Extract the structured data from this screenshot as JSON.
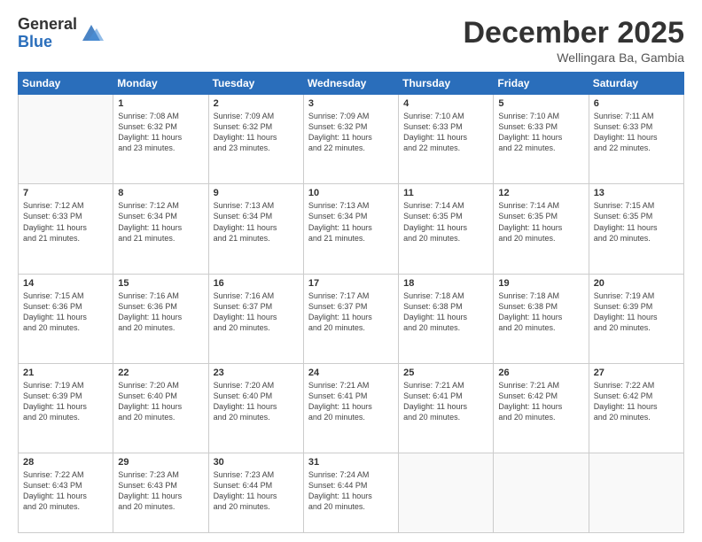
{
  "header": {
    "logo_general": "General",
    "logo_blue": "Blue",
    "month_title": "December 2025",
    "location": "Wellingara Ba, Gambia"
  },
  "days_of_week": [
    "Sunday",
    "Monday",
    "Tuesday",
    "Wednesday",
    "Thursday",
    "Friday",
    "Saturday"
  ],
  "weeks": [
    [
      {
        "num": "",
        "info": ""
      },
      {
        "num": "1",
        "info": "Sunrise: 7:08 AM\nSunset: 6:32 PM\nDaylight: 11 hours\nand 23 minutes."
      },
      {
        "num": "2",
        "info": "Sunrise: 7:09 AM\nSunset: 6:32 PM\nDaylight: 11 hours\nand 23 minutes."
      },
      {
        "num": "3",
        "info": "Sunrise: 7:09 AM\nSunset: 6:32 PM\nDaylight: 11 hours\nand 22 minutes."
      },
      {
        "num": "4",
        "info": "Sunrise: 7:10 AM\nSunset: 6:33 PM\nDaylight: 11 hours\nand 22 minutes."
      },
      {
        "num": "5",
        "info": "Sunrise: 7:10 AM\nSunset: 6:33 PM\nDaylight: 11 hours\nand 22 minutes."
      },
      {
        "num": "6",
        "info": "Sunrise: 7:11 AM\nSunset: 6:33 PM\nDaylight: 11 hours\nand 22 minutes."
      }
    ],
    [
      {
        "num": "7",
        "info": "Sunrise: 7:12 AM\nSunset: 6:33 PM\nDaylight: 11 hours\nand 21 minutes."
      },
      {
        "num": "8",
        "info": "Sunrise: 7:12 AM\nSunset: 6:34 PM\nDaylight: 11 hours\nand 21 minutes."
      },
      {
        "num": "9",
        "info": "Sunrise: 7:13 AM\nSunset: 6:34 PM\nDaylight: 11 hours\nand 21 minutes."
      },
      {
        "num": "10",
        "info": "Sunrise: 7:13 AM\nSunset: 6:34 PM\nDaylight: 11 hours\nand 21 minutes."
      },
      {
        "num": "11",
        "info": "Sunrise: 7:14 AM\nSunset: 6:35 PM\nDaylight: 11 hours\nand 20 minutes."
      },
      {
        "num": "12",
        "info": "Sunrise: 7:14 AM\nSunset: 6:35 PM\nDaylight: 11 hours\nand 20 minutes."
      },
      {
        "num": "13",
        "info": "Sunrise: 7:15 AM\nSunset: 6:35 PM\nDaylight: 11 hours\nand 20 minutes."
      }
    ],
    [
      {
        "num": "14",
        "info": "Sunrise: 7:15 AM\nSunset: 6:36 PM\nDaylight: 11 hours\nand 20 minutes."
      },
      {
        "num": "15",
        "info": "Sunrise: 7:16 AM\nSunset: 6:36 PM\nDaylight: 11 hours\nand 20 minutes."
      },
      {
        "num": "16",
        "info": "Sunrise: 7:16 AM\nSunset: 6:37 PM\nDaylight: 11 hours\nand 20 minutes."
      },
      {
        "num": "17",
        "info": "Sunrise: 7:17 AM\nSunset: 6:37 PM\nDaylight: 11 hours\nand 20 minutes."
      },
      {
        "num": "18",
        "info": "Sunrise: 7:18 AM\nSunset: 6:38 PM\nDaylight: 11 hours\nand 20 minutes."
      },
      {
        "num": "19",
        "info": "Sunrise: 7:18 AM\nSunset: 6:38 PM\nDaylight: 11 hours\nand 20 minutes."
      },
      {
        "num": "20",
        "info": "Sunrise: 7:19 AM\nSunset: 6:39 PM\nDaylight: 11 hours\nand 20 minutes."
      }
    ],
    [
      {
        "num": "21",
        "info": "Sunrise: 7:19 AM\nSunset: 6:39 PM\nDaylight: 11 hours\nand 20 minutes."
      },
      {
        "num": "22",
        "info": "Sunrise: 7:20 AM\nSunset: 6:40 PM\nDaylight: 11 hours\nand 20 minutes."
      },
      {
        "num": "23",
        "info": "Sunrise: 7:20 AM\nSunset: 6:40 PM\nDaylight: 11 hours\nand 20 minutes."
      },
      {
        "num": "24",
        "info": "Sunrise: 7:21 AM\nSunset: 6:41 PM\nDaylight: 11 hours\nand 20 minutes."
      },
      {
        "num": "25",
        "info": "Sunrise: 7:21 AM\nSunset: 6:41 PM\nDaylight: 11 hours\nand 20 minutes."
      },
      {
        "num": "26",
        "info": "Sunrise: 7:21 AM\nSunset: 6:42 PM\nDaylight: 11 hours\nand 20 minutes."
      },
      {
        "num": "27",
        "info": "Sunrise: 7:22 AM\nSunset: 6:42 PM\nDaylight: 11 hours\nand 20 minutes."
      }
    ],
    [
      {
        "num": "28",
        "info": "Sunrise: 7:22 AM\nSunset: 6:43 PM\nDaylight: 11 hours\nand 20 minutes."
      },
      {
        "num": "29",
        "info": "Sunrise: 7:23 AM\nSunset: 6:43 PM\nDaylight: 11 hours\nand 20 minutes."
      },
      {
        "num": "30",
        "info": "Sunrise: 7:23 AM\nSunset: 6:44 PM\nDaylight: 11 hours\nand 20 minutes."
      },
      {
        "num": "31",
        "info": "Sunrise: 7:24 AM\nSunset: 6:44 PM\nDaylight: 11 hours\nand 20 minutes."
      },
      {
        "num": "",
        "info": ""
      },
      {
        "num": "",
        "info": ""
      },
      {
        "num": "",
        "info": ""
      }
    ]
  ]
}
